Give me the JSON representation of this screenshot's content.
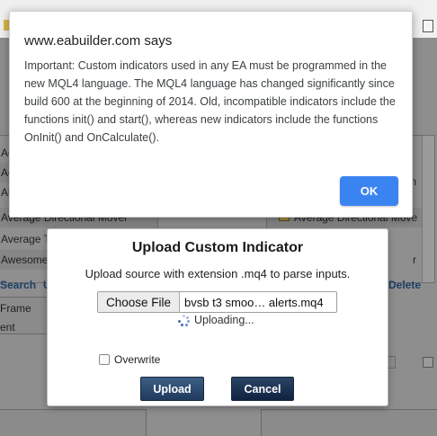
{
  "alert": {
    "title": "www.eabuilder.com says",
    "message": "Important: Custom indicators used in any EA must be programmed in the new MQL4 language. The MQL4 language has changed significantly since build 600 at the beginning of 2014. Old, incompatible indicators include the functions init() and start(), whereas new indicators include the functions OnInit() and OnCalculate().",
    "ok_label": "OK"
  },
  "modal": {
    "title": "Upload Custom Indicator",
    "subtitle": "Upload source with extension .mq4 to parse inputs.",
    "choose_file_label": "Choose File",
    "file_name": "bvsb t3 smoo… alerts.mq4",
    "uploading_text": "Uploading...",
    "overwrite_label": "Overwrite",
    "upload_label": "Upload",
    "cancel_label": "Cancel"
  },
  "background": {
    "left_list": [
      "Ac",
      "Ac",
      "Al",
      "Average Directional Mover",
      "Average T",
      "Awesome"
    ],
    "right_list": [
      "",
      "",
      "n",
      "Average Directional Move",
      "",
      "r"
    ],
    "search_link": "Search",
    "search_link_2": "U",
    "delete_link": "Delete",
    "frame_label": "Frame",
    "ent_label": "ent"
  }
}
